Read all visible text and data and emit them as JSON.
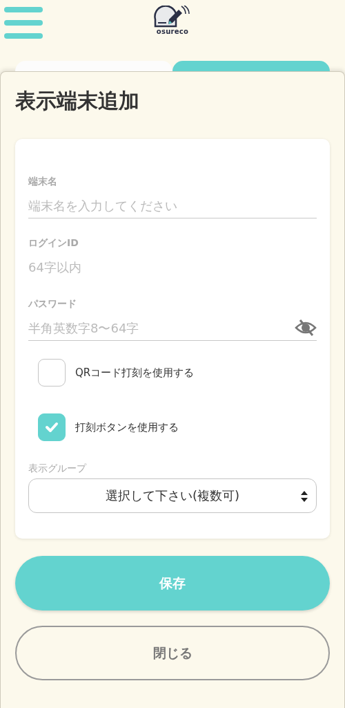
{
  "header": {
    "logo_text": "osureco"
  },
  "tabs": [
    {
      "selected": false
    },
    {
      "selected": true
    }
  ],
  "dialog": {
    "title": "表示端末追加",
    "fields": [
      {
        "kind": "text",
        "label": "端末名",
        "placeholder": "端末名を入力してください"
      },
      {
        "kind": "plain",
        "label": "ログインID",
        "placeholder": "64字以内"
      },
      {
        "kind": "password",
        "label": "パスワード",
        "placeholder": "半角英数字8〜64字"
      }
    ],
    "checkboxes": [
      {
        "label": "QRコード打刻を使用する",
        "checked": false
      },
      {
        "label": "打刻ボタンを使用する",
        "checked": true
      }
    ],
    "select": {
      "label": "表示グループ",
      "placeholder": "選択して下さい(複数可)"
    },
    "buttons": [
      {
        "kind": "primary",
        "label": "保存"
      },
      {
        "kind": "secondary",
        "label": "閉じる"
      }
    ]
  }
}
